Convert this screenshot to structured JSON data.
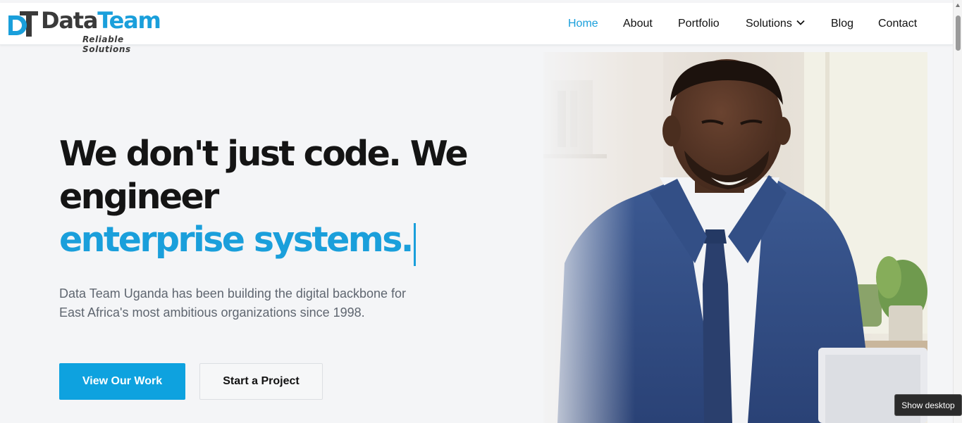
{
  "brand": {
    "name_part1": "Data",
    "name_part2": "Team",
    "tagline": "Reliable Solutions",
    "mark_letters": "DT"
  },
  "nav": {
    "items": [
      {
        "label": "Home",
        "active": true
      },
      {
        "label": "About"
      },
      {
        "label": "Portfolio"
      },
      {
        "label": "Solutions",
        "has_dropdown": true
      },
      {
        "label": "Blog"
      },
      {
        "label": "Contact"
      }
    ]
  },
  "hero": {
    "title_line1": "We don't just code. We",
    "title_line2": "engineer",
    "title_highlight": "enterprise systems.",
    "description": "Data Team Uganda has been building the digital backbone for East Africa's most ambitious organizations since 1998.",
    "primary_cta": "View Our Work",
    "secondary_cta": "Start a Project"
  },
  "tooltip": {
    "text": "Show desktop"
  },
  "colors": {
    "accent": "#1a9fdb",
    "primary_button": "#0ea2df",
    "background": "#f4f5f7",
    "heading": "#141414",
    "body_text": "#5f6670"
  }
}
